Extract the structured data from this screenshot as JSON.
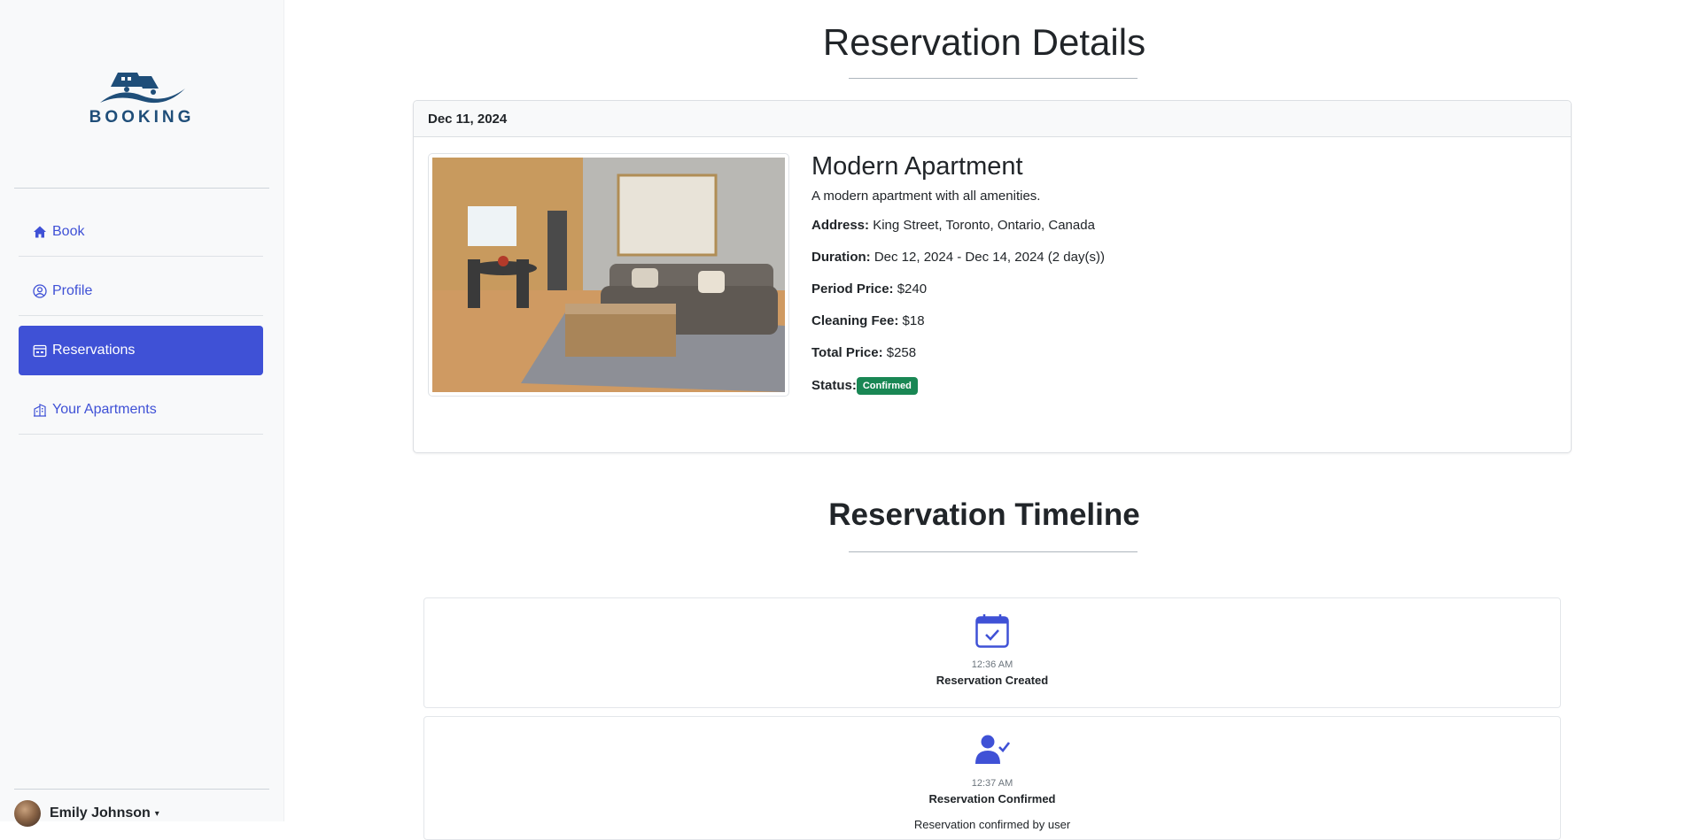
{
  "brand": {
    "name": "BOOKING",
    "color": "#1f4e79"
  },
  "sidebar": {
    "items": [
      {
        "label": "Book",
        "icon": "house-icon"
      },
      {
        "label": "Profile",
        "icon": "person-circle-icon"
      },
      {
        "label": "Reservations",
        "icon": "calendar-icon",
        "active": true
      },
      {
        "label": "Your Apartments",
        "icon": "buildings-icon"
      }
    ],
    "user": {
      "name": "Emily Johnson"
    }
  },
  "page": {
    "title": "Reservation Details"
  },
  "reservation": {
    "date": "Dec 11, 2024",
    "name": "Modern Apartment",
    "description": "A modern apartment with all amenities.",
    "address_label": "Address:",
    "address": "King Street, Toronto, Ontario, Canada",
    "duration_label": "Duration:",
    "duration": "Dec 12, 2024 - Dec 14, 2024 (2 day(s))",
    "period_price_label": "Period Price:",
    "period_price": "$240",
    "cleaning_fee_label": "Cleaning Fee:",
    "cleaning_fee": "$18",
    "total_price_label": "Total Price:",
    "total_price": "$258",
    "status_label": "Status:",
    "status": "Confirmed",
    "status_color": "#198754"
  },
  "timeline": {
    "title": "Reservation Timeline",
    "events": [
      {
        "icon": "calendar-check-icon",
        "time": "12:36 AM",
        "title": "Reservation Created",
        "description": ""
      },
      {
        "icon": "person-check-icon",
        "time": "12:37 AM",
        "title": "Reservation Confirmed",
        "description": "Reservation confirmed by user"
      }
    ]
  },
  "accent_color": "#3f51d6"
}
